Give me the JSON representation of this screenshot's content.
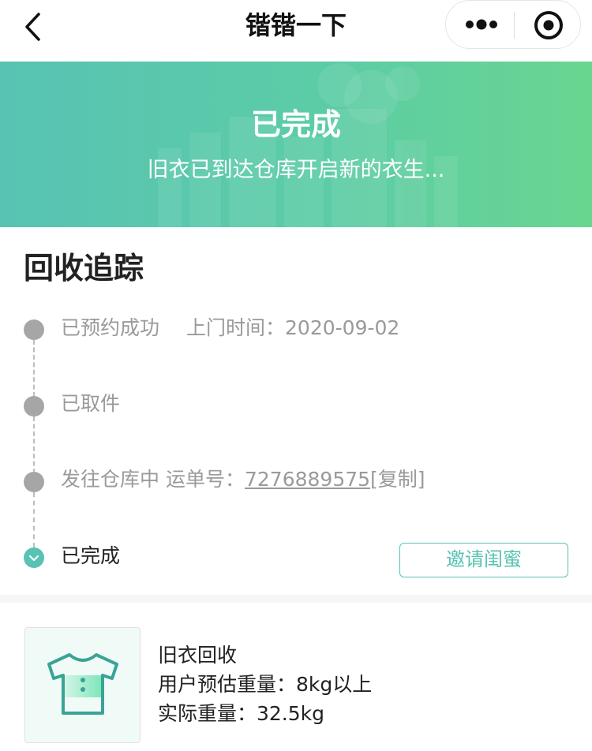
{
  "nav": {
    "title": "锴锴一下",
    "back_icon": "chevron-left-icon",
    "more_icon": "more-dots-icon",
    "close_icon": "target-circle-icon"
  },
  "banner": {
    "title": "已完成",
    "subtitle": "旧衣已到达仓库开启新的衣生...",
    "gradient_start": "#58c3b3",
    "gradient_end": "#69d690"
  },
  "tracking": {
    "title": "回收追踪",
    "steps": [
      {
        "label": "已预约成功",
        "extra": "上门时间：2020-09-02",
        "status": "past"
      },
      {
        "label": "已取件",
        "status": "past"
      },
      {
        "label": "发往仓库中",
        "waybill_label": "运单号：",
        "waybill_number": "7276889575",
        "copy_label": "[复制]",
        "status": "past"
      },
      {
        "label": "已完成",
        "status": "current"
      }
    ],
    "invite_button": "邀请闺蜜",
    "accent_color": "#58c3b3"
  },
  "item": {
    "icon": "tshirt-icon",
    "name": "旧衣回收",
    "estimated_weight": "用户预估重量：8kg以上",
    "actual_weight": "实际重量：32.5kg"
  }
}
